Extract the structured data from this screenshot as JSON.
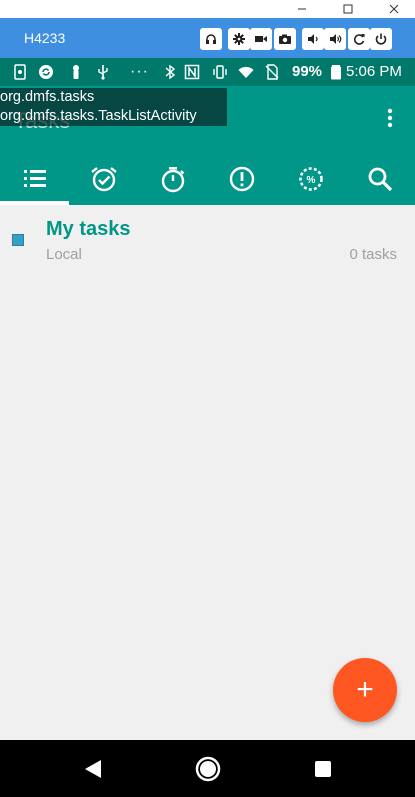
{
  "window": {
    "title": "H4233",
    "minimize_icon": "minimize-icon",
    "maximize_icon": "maximize-icon",
    "close_icon": "close-icon"
  },
  "emulator_toolbar": [
    "headset-icon",
    "gear-icon",
    "video-camera-icon",
    "camera-icon",
    "volume-down-icon",
    "volume-up-icon",
    "rotate-icon",
    "power-icon"
  ],
  "status_bar": {
    "icons": [
      "screenshot-icon",
      "sync-icon",
      "notification-icon",
      "usb-icon",
      "more-dots-icon",
      "bluetooth-icon",
      "nfc-icon",
      "vibrate-icon",
      "wifi-icon",
      "no-sim-icon",
      "battery-icon"
    ],
    "battery": "99%",
    "time": "5:06 PM"
  },
  "debug_overlay": {
    "line1": "org.dmfs.tasks",
    "line2": "org.dmfs.tasks.TaskListActivity"
  },
  "app_bar": {
    "title": "Tasks",
    "overflow_icon": "more-vert-icon",
    "tabs": [
      {
        "icon": "list-icon",
        "selected": true
      },
      {
        "icon": "alarm-check-icon",
        "selected": false
      },
      {
        "icon": "timer-icon",
        "selected": false
      },
      {
        "icon": "priority-icon",
        "selected": false
      },
      {
        "icon": "progress-icon",
        "selected": false
      },
      {
        "icon": "search-icon",
        "selected": false
      }
    ]
  },
  "task_lists": [
    {
      "name": "My tasks",
      "account": "Local",
      "count": "0 tasks",
      "color": "#3a9ec6"
    }
  ],
  "fab": {
    "label": "+",
    "color": "#ff5722"
  },
  "nav_bar": [
    "back-icon",
    "home-icon",
    "recents-icon"
  ],
  "colors": {
    "primary": "#009688",
    "primary_dark": "#00796b",
    "accent": "#ff5722",
    "emulator": "#3f8fe0"
  }
}
